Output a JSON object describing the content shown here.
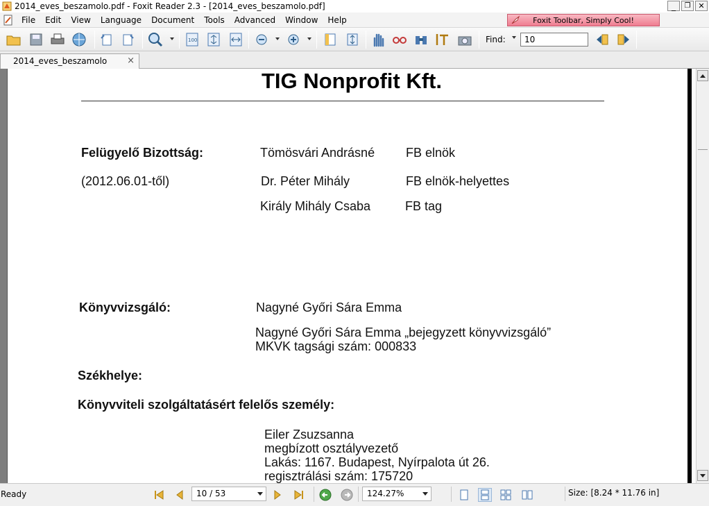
{
  "window": {
    "title": "2014_eves_beszamolo.pdf - Foxit Reader 2.3 - [2014_eves_beszamolo.pdf]",
    "minimize": "_",
    "restore": "❐",
    "close": "✕"
  },
  "menu": {
    "items": [
      "File",
      "Edit",
      "View",
      "Language",
      "Document",
      "Tools",
      "Advanced",
      "Window",
      "Help"
    ],
    "promo": "Foxit Toolbar, Simply Cool!"
  },
  "toolbar": {
    "find_label": "Find:",
    "find_value": "10"
  },
  "tab": {
    "label": "2014_eves_beszamolo",
    "close": "×"
  },
  "document": {
    "title": "TIG Nonprofit Kft.",
    "supervisory_board": {
      "heading": "Felügyelő Bizottság:",
      "since": "(2012.06.01-től)",
      "members": [
        {
          "name": "Tömösvári Andrásné",
          "role": "FB elnök"
        },
        {
          "name": "Dr. Péter Mihály",
          "role": "FB elnök-helyettes"
        },
        {
          "name": "Király Mihály Csaba",
          "role": "FB tag"
        }
      ]
    },
    "auditor": {
      "heading": "Könyvvizsgáló:",
      "name": "Nagyné Győri Sára Emma",
      "line1": "Nagyné Győri Sára Emma „bejegyzett könyvvizsgáló”",
      "line2": "MKVK tagsági szám: 000833"
    },
    "seat": {
      "heading": "Székhelye:"
    },
    "bookkeeping": {
      "heading": "Könyvviteli szolgáltatásért felelős személy:",
      "lines": [
        "Eiler Zsuzsanna",
        "megbízott osztályvezető",
        "Lakás: 1167. Budapest, Nyírpalota út 26.",
        "regisztrálási szám: 175720"
      ]
    }
  },
  "status": {
    "ready": "Ready",
    "page": "10 / 53",
    "zoom": "124.27%",
    "size": "Size: [8.24 * 11.76 in]"
  }
}
